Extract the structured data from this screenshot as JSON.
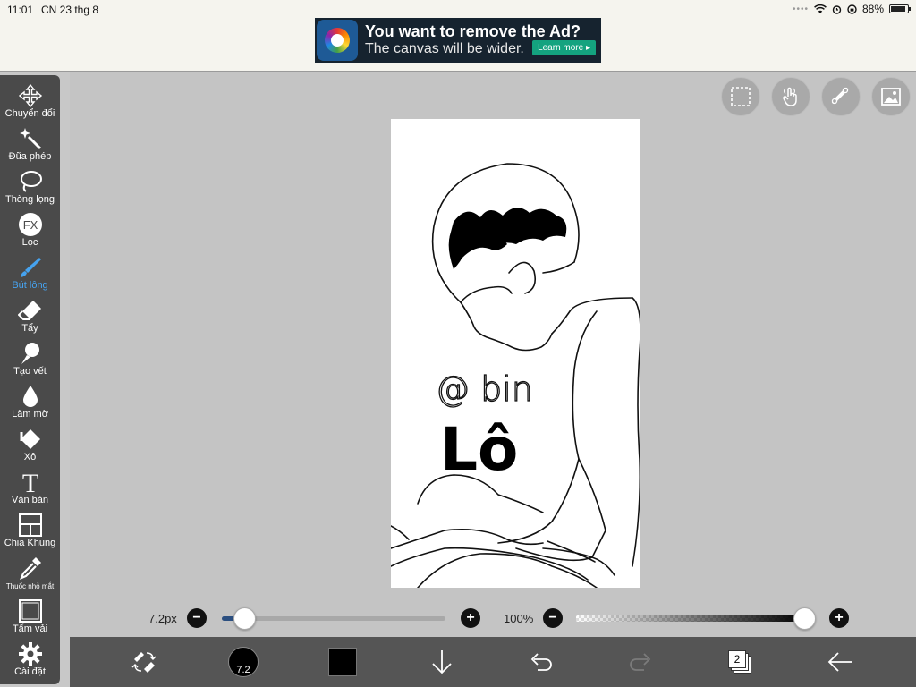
{
  "status_bar": {
    "time": "11:01",
    "date": "CN 23 thg 8",
    "battery": "88%"
  },
  "ad": {
    "title": "You want to remove the Ad?",
    "subtitle": "The canvas will be wider.",
    "button": "Learn more ▸"
  },
  "toolbar": {
    "items": [
      {
        "label": "Chuyển đổi",
        "icon": "move-icon"
      },
      {
        "label": "Đũa phép",
        "icon": "magic-wand-icon"
      },
      {
        "label": "Thòng lọng",
        "icon": "lasso-icon"
      },
      {
        "label": "Lọc",
        "icon": "fx-filter-icon"
      },
      {
        "label": "Bút lông",
        "icon": "brush-icon"
      },
      {
        "label": "Tẩy",
        "icon": "eraser-icon"
      },
      {
        "label": "Tạo vết",
        "icon": "smudge-icon"
      },
      {
        "label": "Làm mờ",
        "icon": "blur-drop-icon"
      },
      {
        "label": "Xô",
        "icon": "bucket-icon"
      },
      {
        "label": "Văn bản",
        "icon": "text-icon"
      },
      {
        "label": "Chia Khung",
        "icon": "frame-divider-icon"
      },
      {
        "label": "Thuốc nhỏ mắt",
        "icon": "eyedropper-icon"
      },
      {
        "label": "Tấm vải",
        "icon": "canvas-icon"
      },
      {
        "label": "Cài đặt",
        "icon": "gear-icon"
      }
    ],
    "active_index": 4
  },
  "canvas": {
    "text_handle": "@ bin",
    "text_title": "Lô"
  },
  "sliders": {
    "brush_size": "7.2px",
    "brush_size_fraction": 0.1,
    "opacity": "100%",
    "opacity_fraction": 1.0,
    "plus": "+",
    "minus": "−"
  },
  "bottom_bar": {
    "brush_size_badge": "7.2",
    "layer_count": "2"
  },
  "colors": {
    "toolbar_bg": "#4a4a4a",
    "active_tool": "#46a3f0",
    "slider_fill": "#2b4f80",
    "bottom_bar_bg": "#555555"
  }
}
